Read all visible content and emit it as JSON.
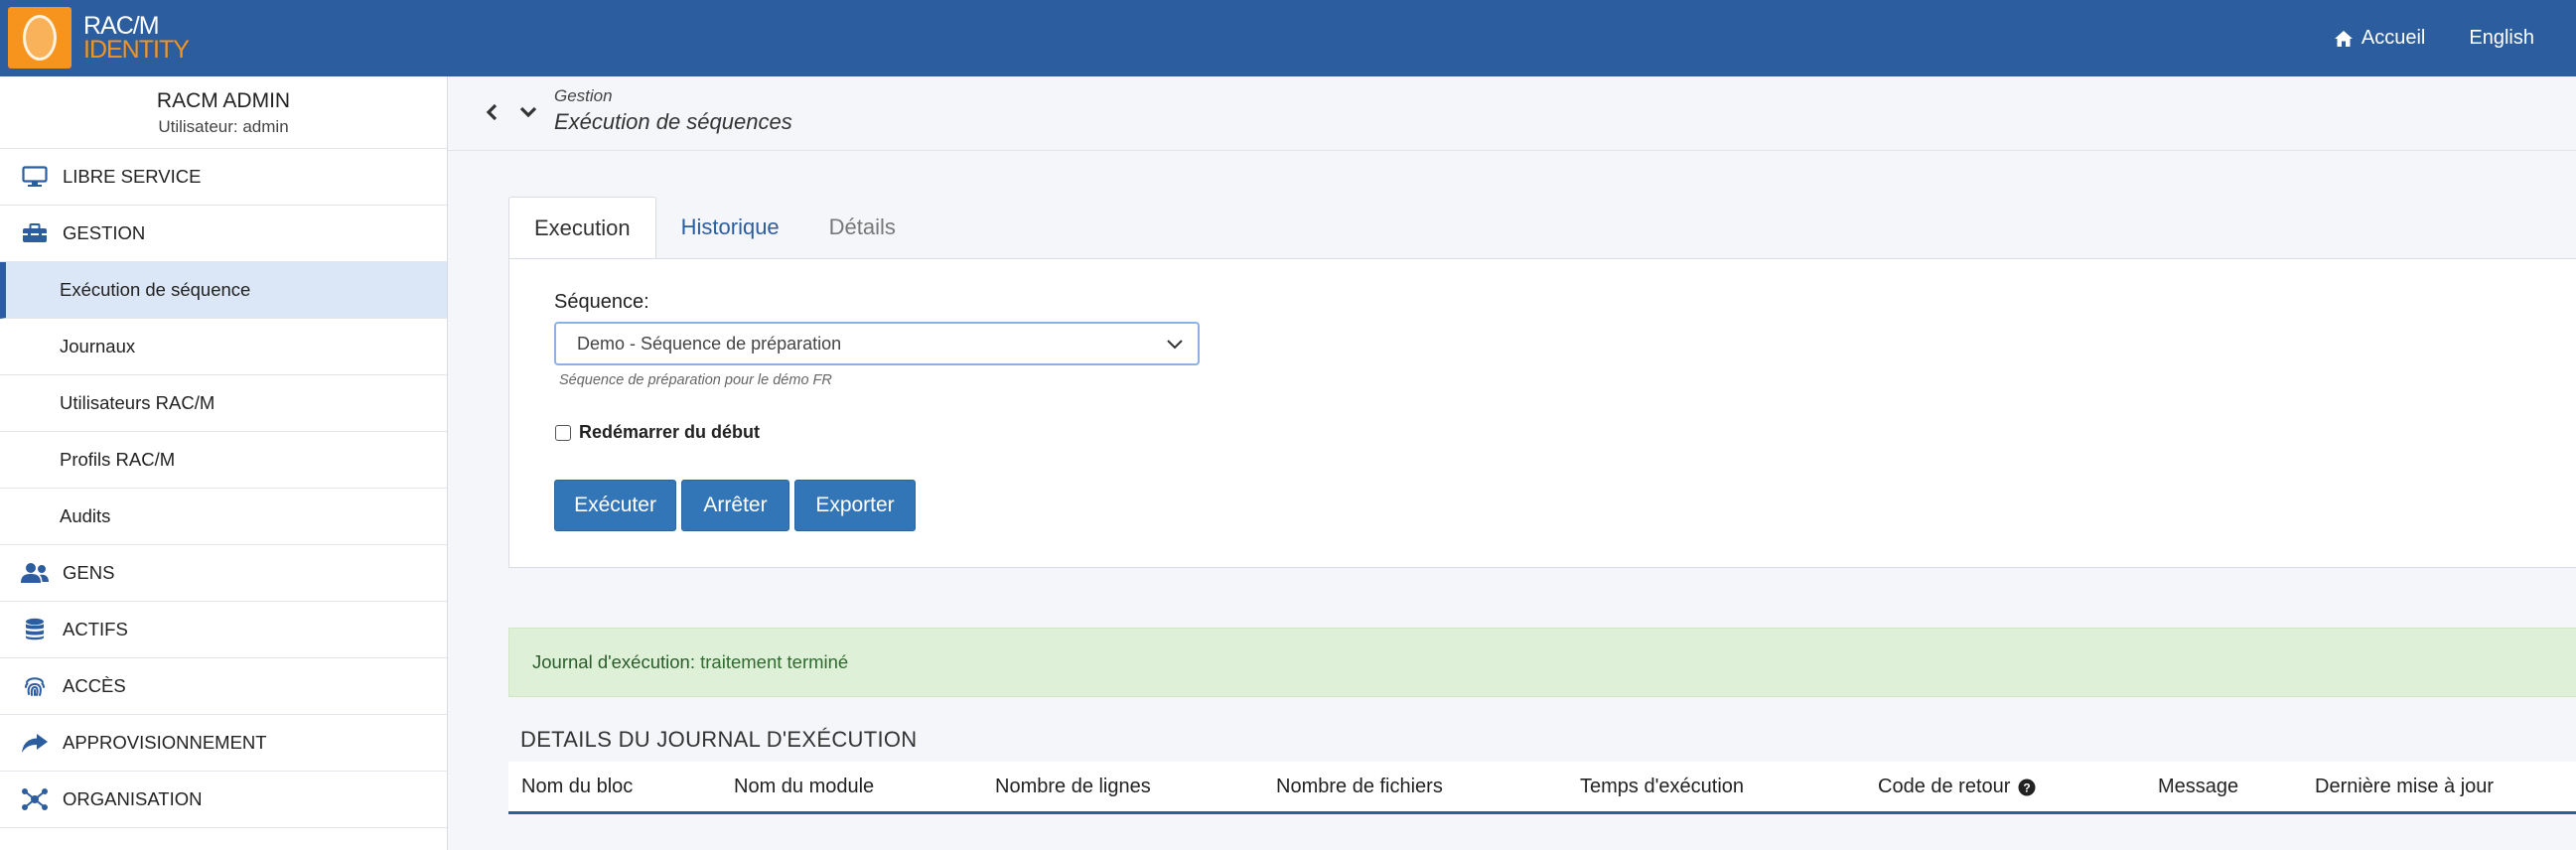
{
  "app": {
    "logo_line1": "RAC/M",
    "logo_line2": "IDENTITY",
    "accent_color": "#2c5d9f",
    "logo_color": "#f7941e"
  },
  "topnav": {
    "home_label": "Accueil",
    "home_icon": "home-icon",
    "lang_label": "English"
  },
  "user": {
    "name": "RACM ADMIN",
    "subtitle": "Utilisateur: admin"
  },
  "sidebar": {
    "items": [
      {
        "label": "LIBRE SERVICE",
        "icon": "monitor-icon"
      },
      {
        "label": "GESTION",
        "icon": "toolbox-icon"
      },
      {
        "label": "GENS",
        "icon": "users-icon"
      },
      {
        "label": "ACTIFS",
        "icon": "database-icon"
      },
      {
        "label": "ACCÈS",
        "icon": "fingerprint-icon"
      },
      {
        "label": "APPROVISIONNEMENT",
        "icon": "share-icon"
      },
      {
        "label": "ORGANISATION",
        "icon": "network-icon"
      }
    ],
    "subitems": [
      {
        "label": "Exécution de séquence",
        "active": true
      },
      {
        "label": "Journaux"
      },
      {
        "label": "Utilisateurs RAC/M"
      },
      {
        "label": "Profils RAC/M"
      },
      {
        "label": "Audits"
      }
    ]
  },
  "header": {
    "breadcrumb": "Gestion",
    "title": "Exécution de séquences"
  },
  "tabs": [
    {
      "label": "Execution",
      "active": true
    },
    {
      "label": "Historique"
    },
    {
      "label": "Détails"
    }
  ],
  "form": {
    "sequence_label": "Séquence:",
    "sequence_value": "Demo - Séquence de préparation",
    "sequence_help": "Séquence de préparation pour le démo FR",
    "restart_label": "Redémarrer du début",
    "restart_checked": false,
    "buttons": {
      "execute": "Exécuter",
      "stop": "Arrêter",
      "export": "Exporter"
    }
  },
  "alert": {
    "key": "Journal d'exécution:",
    "value": "traitement terminé"
  },
  "details": {
    "title": "DETAILS DU JOURNAL D'EXÉCUTION",
    "columns": [
      "Nom du bloc",
      "Nom du module",
      "Nombre de lignes",
      "Nombre de fichiers",
      "Temps d'exécution",
      "Code de retour",
      "Message",
      "Dernière mise à jour"
    ]
  }
}
